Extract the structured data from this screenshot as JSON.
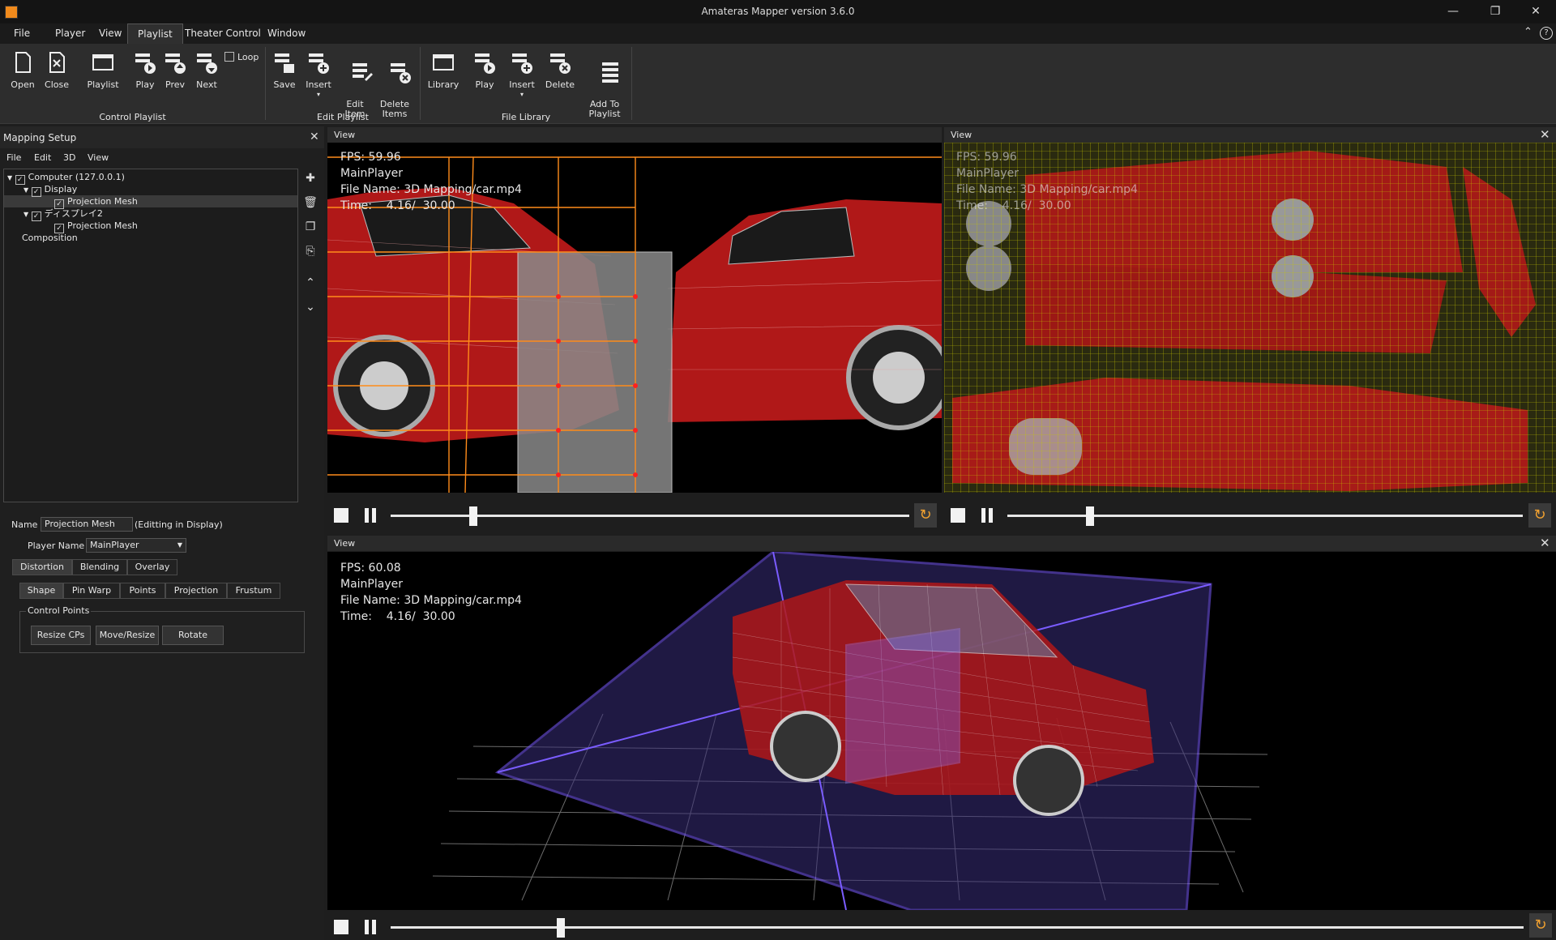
{
  "window": {
    "title": "Amateras Mapper version 3.6.0"
  },
  "menu": [
    "File",
    "Player",
    "View",
    "Playlist",
    "Theater Control",
    "Window"
  ],
  "ribbon": {
    "control_playlist": {
      "label": "Control Playlist",
      "buttons": [
        "Open",
        "Close",
        "Playlist",
        "Play",
        "Prev",
        "Next"
      ],
      "loop_label": "Loop"
    },
    "edit_playlist": {
      "label": "Edit Playlist",
      "buttons": [
        "Save",
        "Insert",
        "Edit\nItem",
        "Delete\nItems"
      ]
    },
    "file_library": {
      "label": "File Library",
      "buttons": [
        "Library",
        "Play",
        "Insert",
        "Delete",
        "Add To\nPlaylist"
      ]
    }
  },
  "mapping_setup": {
    "title": "Mapping Setup",
    "menu": [
      "File",
      "Edit",
      "3D",
      "View"
    ],
    "tree": [
      {
        "label": "Computer (127.0.0.1)"
      },
      {
        "label": "Display"
      },
      {
        "label": "Projection Mesh"
      },
      {
        "label": "ディスプレイ2"
      },
      {
        "label": "Projection Mesh"
      },
      {
        "label": "Composition"
      }
    ],
    "name_label": "Name",
    "name_value": "Projection Mesh",
    "editing_note": "(Editting in Display)",
    "player_name_label": "Player Name",
    "player_name_value": "MainPlayer",
    "tabs": [
      "Distortion",
      "Blending",
      "Overlay"
    ],
    "subtabs": [
      "Shape",
      "Pin Warp",
      "Points",
      "Projection",
      "Frustum"
    ],
    "control_points_label": "Control Points",
    "buttons": [
      "Resize CPs",
      "Move/Resize",
      "Rotate"
    ]
  },
  "views": [
    {
      "title": "View",
      "fps": "FPS: 59.96",
      "player": "MainPlayer",
      "file": "File Name: 3D Mapping/car.mp4",
      "time": "Time:    4.16/  30.00",
      "progress": 0.16
    },
    {
      "title": "View",
      "fps": "FPS: 59.96",
      "player": "MainPlayer",
      "file": "File Name: 3D Mapping/car.mp4",
      "time": "Time:    4.16/  30.00",
      "progress": 0.16
    },
    {
      "title": "View",
      "fps": "FPS: 60.08",
      "player": "MainPlayer",
      "file": "File Name: 3D Mapping/car.mp4",
      "time": "Time:    4.16/  30.00",
      "progress": 0.15
    }
  ],
  "colors": {
    "accent": "#f0a030",
    "mesh": "#ff8c1a",
    "frustum": "#7a5cff",
    "car": "#c01818"
  }
}
